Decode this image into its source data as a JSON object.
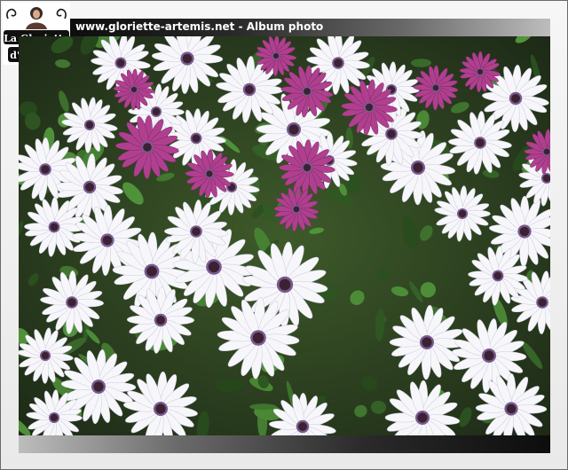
{
  "header": {
    "title": "www.gloriette-artemis.net - Album photo"
  },
  "logo": {
    "line1": "La Gloriette",
    "line2": "d'Artémis"
  },
  "photo": {
    "subject": "daisies",
    "colors": {
      "foliage": "#27361e",
      "white_petal": "#f7f7fb",
      "purple_petal": "#b0408f",
      "center": "#3a2233"
    }
  }
}
